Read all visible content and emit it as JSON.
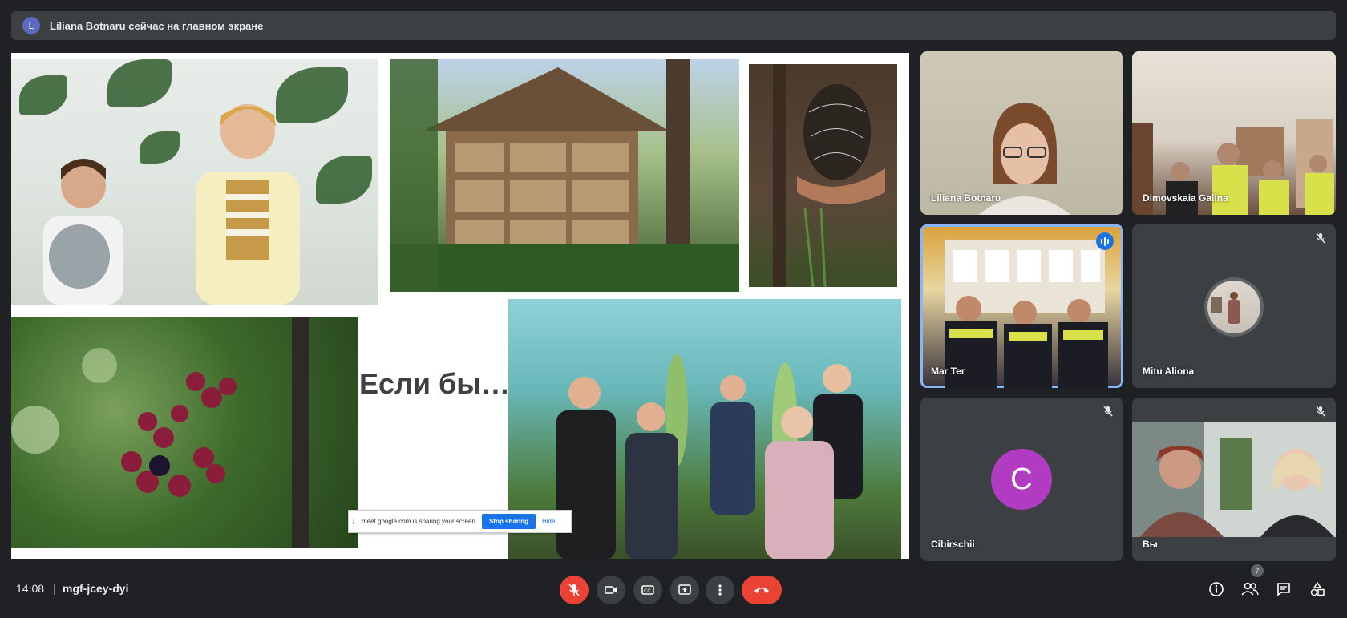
{
  "banner": {
    "avatar_letter": "L",
    "text": "Liliana Botnaru сейчас на главном экране"
  },
  "slide": {
    "title": "Если бы…"
  },
  "share_bar": {
    "message": "meet.google.com is sharing your screen.",
    "stop_label": "Stop sharing",
    "hide_label": "Hide"
  },
  "participants": [
    {
      "name": "Liliana Botnaru"
    },
    {
      "name": "Dimovskaia Galina"
    },
    {
      "name": "Mar Ter"
    },
    {
      "name": "Mitu Aliona"
    },
    {
      "name": "Cibirschii",
      "avatar_letter": "C"
    },
    {
      "name": "Вы"
    }
  ],
  "footer": {
    "time": "14:08",
    "separator": "|",
    "meeting_code": "mgf-jcey-dyi",
    "people_count": "7"
  },
  "colors": {
    "end_call": "#ea4335",
    "active_speaker": "#8ab4f8",
    "avatar_c": "#b23cc1"
  }
}
